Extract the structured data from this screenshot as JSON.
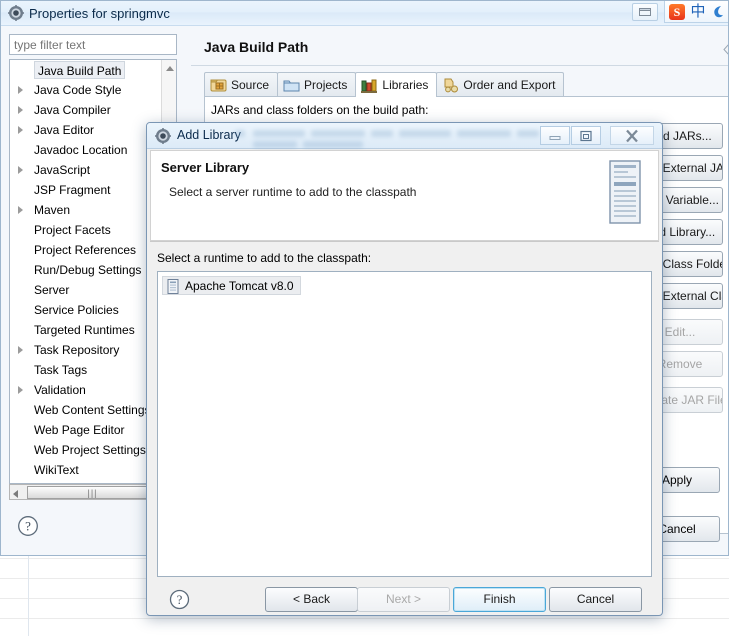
{
  "window": {
    "title": "Properties for springmvc",
    "icon": "eclipse-gear-icon",
    "restore_button": "restore-button"
  },
  "ime": {
    "logo": "S",
    "mode": "中",
    "moon": "moon-icon"
  },
  "filter": {
    "value": "",
    "placeholder": "type filter text"
  },
  "tree": {
    "items": [
      {
        "label": "Java Build Path",
        "expandable": false,
        "selected": true
      },
      {
        "label": "Java Code Style",
        "expandable": true,
        "selected": false
      },
      {
        "label": "Java Compiler",
        "expandable": true,
        "selected": false
      },
      {
        "label": "Java Editor",
        "expandable": true,
        "selected": false
      },
      {
        "label": "Javadoc Location",
        "expandable": false,
        "selected": false
      },
      {
        "label": "JavaScript",
        "expandable": true,
        "selected": false
      },
      {
        "label": "JSP Fragment",
        "expandable": false,
        "selected": false
      },
      {
        "label": "Maven",
        "expandable": true,
        "selected": false
      },
      {
        "label": "Project Facets",
        "expandable": false,
        "selected": false
      },
      {
        "label": "Project References",
        "expandable": false,
        "selected": false
      },
      {
        "label": "Run/Debug Settings",
        "expandable": false,
        "selected": false
      },
      {
        "label": "Server",
        "expandable": false,
        "selected": false
      },
      {
        "label": "Service Policies",
        "expandable": false,
        "selected": false
      },
      {
        "label": "Targeted Runtimes",
        "expandable": false,
        "selected": false
      },
      {
        "label": "Task Repository",
        "expandable": true,
        "selected": false
      },
      {
        "label": "Task Tags",
        "expandable": false,
        "selected": false
      },
      {
        "label": "Validation",
        "expandable": true,
        "selected": false
      },
      {
        "label": "Web Content Settings",
        "expandable": false,
        "selected": false
      },
      {
        "label": "Web Page Editor",
        "expandable": false,
        "selected": false
      },
      {
        "label": "Web Project Settings",
        "expandable": false,
        "selected": false
      },
      {
        "label": "WikiText",
        "expandable": false,
        "selected": false
      }
    ]
  },
  "content": {
    "title": "Java Build Path",
    "tabs": [
      {
        "label": "Source",
        "icon": "source-folder-icon",
        "active": false
      },
      {
        "label": "Projects",
        "icon": "projects-icon",
        "active": false
      },
      {
        "label": "Libraries",
        "icon": "libraries-icon",
        "active": true
      },
      {
        "label": "Order and Export",
        "icon": "order-export-icon",
        "active": false
      }
    ],
    "body_label": "JARs and class folders on the build path:",
    "side_buttons": [
      {
        "label": "Add JARs...",
        "disabled": false
      },
      {
        "label": "Add External JARs...",
        "disabled": false
      },
      {
        "label": "Add Variable...",
        "disabled": false
      },
      {
        "label": "Add Library...",
        "disabled": false
      },
      {
        "label": "Add Class Folder...",
        "disabled": false
      },
      {
        "label": "Add External Class Folder...",
        "disabled": false
      },
      {
        "label": "Edit...",
        "disabled": true
      },
      {
        "label": "Remove",
        "disabled": true
      },
      {
        "label": "Migrate JAR File...",
        "disabled": true
      }
    ],
    "apply_label": "Apply",
    "cancel_label": "Cancel"
  },
  "dialog": {
    "title": "Add Library",
    "icon": "eclipse-gear-icon",
    "titlebar_buttons": [
      {
        "name": "minimize-button"
      },
      {
        "name": "maximize-button"
      },
      {
        "name": "close-button"
      }
    ],
    "header_title": "Server Library",
    "header_subtitle": "Select a server runtime to add to the classpath",
    "header_image": "server-tower-icon",
    "prompt": "Select a runtime to add to the classpath:",
    "list_items": [
      {
        "label": "Apache Tomcat v8.0",
        "icon": "server-runtime-icon",
        "selected": true
      }
    ],
    "buttons": [
      {
        "label": "< Back",
        "state": "enabled"
      },
      {
        "label": "Next >",
        "state": "disabled"
      },
      {
        "label": "Finish",
        "state": "default"
      },
      {
        "label": "Cancel",
        "state": "enabled"
      }
    ],
    "help": "help-icon"
  },
  "colors": {
    "titlebar": "#e3f0fb",
    "dialog_border": "#7a96b4",
    "default_button_border": "#4aa7d8",
    "ime_red": "#e8331a",
    "ime_blue": "#1f63b8"
  }
}
